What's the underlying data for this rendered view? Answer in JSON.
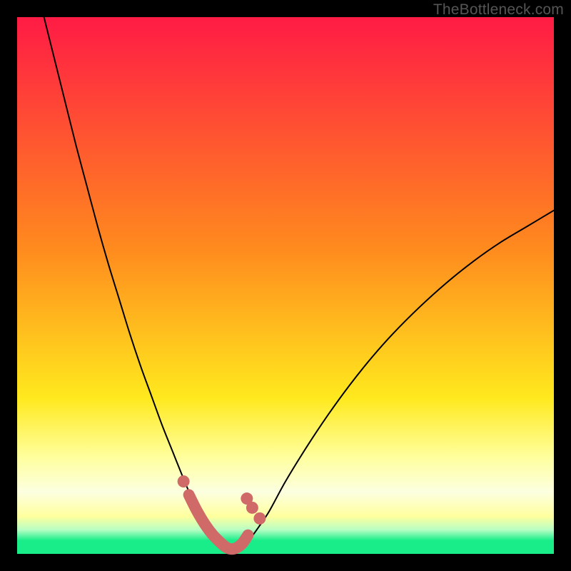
{
  "watermark": "TheBottleneck.com",
  "colors": {
    "black": "#000000",
    "red": "#ff1b45",
    "orange": "#ff8a1e",
    "yellow": "#ffe91e",
    "paleYellow": "#ffff9e",
    "cream": "#fcffe0",
    "green": "#19ed8a",
    "curve": "#000000",
    "marker": "#cf6a68"
  },
  "chart_data": {
    "type": "line",
    "title": "",
    "xlabel": "",
    "ylabel": "",
    "xlim": [
      0,
      100
    ],
    "ylim": [
      0,
      100
    ],
    "series": [
      {
        "name": "left-curve",
        "x": [
          5,
          7,
          9,
          11,
          13,
          15,
          17,
          19,
          21,
          23,
          25,
          27,
          29,
          31,
          32.5,
          34,
          35.5,
          37,
          38,
          39,
          40
        ],
        "values": [
          100,
          92,
          84,
          76,
          68.5,
          61,
          54,
          47.5,
          41,
          35,
          29.5,
          24,
          19,
          14,
          10.5,
          7.5,
          5,
          3,
          1.8,
          1,
          0.6
        ]
      },
      {
        "name": "right-curve",
        "x": [
          40,
          41,
          42,
          43.5,
          45,
          47,
          50,
          54,
          58,
          62,
          66,
          70,
          75,
          80,
          85,
          90,
          95,
          100
        ],
        "values": [
          0.6,
          1,
          1.8,
          3,
          5,
          8,
          13.5,
          20,
          26,
          31.5,
          36.5,
          41,
          46,
          50.5,
          54.5,
          58,
          61,
          64
        ]
      },
      {
        "name": "marker-dots",
        "x": [
          31,
          42.8,
          43.8,
          45.2
        ],
        "values": [
          13.5,
          10.3,
          8.6,
          6.6
        ]
      },
      {
        "name": "marker-smudge",
        "x": [
          32,
          33.5,
          35,
          36.5,
          38,
          39,
          40,
          41,
          42,
          43
        ],
        "values": [
          11,
          8,
          5.5,
          3.5,
          2,
          1.2,
          0.9,
          1.2,
          2,
          3.5
        ]
      }
    ],
    "gradient_stops": [
      {
        "offset": 0,
        "color": "#ff1b45"
      },
      {
        "offset": 0.43,
        "color": "#ff8a1e"
      },
      {
        "offset": 0.71,
        "color": "#ffe91e"
      },
      {
        "offset": 0.82,
        "color": "#ffff9e"
      },
      {
        "offset": 0.885,
        "color": "#fcffe0"
      },
      {
        "offset": 0.93,
        "color": "#ffff9e"
      },
      {
        "offset": 0.955,
        "color": "#b8ffc4"
      },
      {
        "offset": 0.975,
        "color": "#19ed8a"
      },
      {
        "offset": 1.0,
        "color": "#19ed8a"
      }
    ]
  }
}
